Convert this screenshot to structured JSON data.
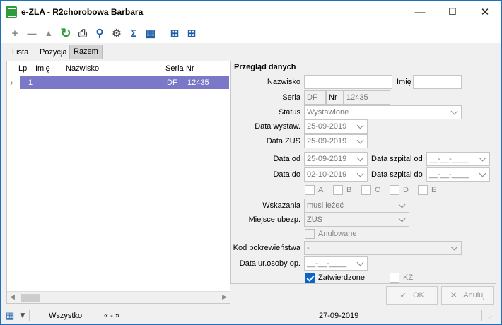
{
  "window": {
    "title": "e-ZLA - R2chorobowa Barbara",
    "minimize": "—",
    "maximize": "☐",
    "close": "✕"
  },
  "toolbar": {
    "add": "+",
    "remove": "—",
    "filter": "▲",
    "refresh": "↻",
    "print": "⎙",
    "search": "⚲",
    "settings": "⚙",
    "sum": "Σ",
    "columns": "▦",
    "tool1": "⊞",
    "tool2": "⊞"
  },
  "tabs": [
    "Lista",
    "Pozycja",
    "Razem"
  ],
  "grid": {
    "columns": [
      "Lp",
      "Imię",
      "Nazwisko",
      "Seria",
      "Nr"
    ],
    "rows": [
      {
        "lp": "1",
        "imie": "",
        "nazwisko": "",
        "seria": "DF",
        "nr": "12435"
      }
    ],
    "row_marker": "›"
  },
  "form": {
    "title": "Przegląd danych",
    "nazwisko_label": "Nazwisko",
    "nazwisko_value": "",
    "imie_label": "Imię",
    "imie_value": "",
    "seria_label": "Seria",
    "seria_value": "DF",
    "nr_label": "Nr",
    "nr_value": "12435",
    "status_label": "Status",
    "status_value": "Wystawione",
    "data_wystaw_label": "Data wystaw.",
    "data_wystaw_value": "25-09-2019",
    "data_zus_label": "Data ZUS",
    "data_zus_value": "25-09-2019",
    "data_od_label": "Data od",
    "data_od_value": "25-09-2019",
    "data_do_label": "Data do",
    "data_do_value": "02-10-2019",
    "szpital_od_label": "Data szpital od",
    "szpital_od_value": "__-__-____",
    "szpital_do_label": "Data szpital do",
    "szpital_do_value": "__-__-____",
    "checks": [
      "A",
      "B",
      "C",
      "D",
      "E"
    ],
    "wskazania_label": "Wskazania",
    "wskazania_value": "musi leżeć",
    "miejsce_label": "Miejsce ubezp.",
    "miejsce_value": "ZUS",
    "anulowane_label": "Anulowane",
    "kod_label": "Kod pokrewieństwa",
    "kod_value": "-",
    "data_ur_label": "Data ur.osoby op.",
    "data_ur_value": "__-__-____",
    "zatwierdzone_label": "Zatwierdzone",
    "zatwierdzone_checked": true,
    "kz_label": "KZ"
  },
  "buttons": {
    "ok": "OK",
    "anuluj": "Anuluj"
  },
  "statusbar": {
    "filter": "Wszystko",
    "nav": "« - »",
    "date": "27-09-2019"
  },
  "colors": {
    "selection": "#7b79c7",
    "accent": "#0a63c9",
    "app_icon": "#2e9c3b"
  }
}
